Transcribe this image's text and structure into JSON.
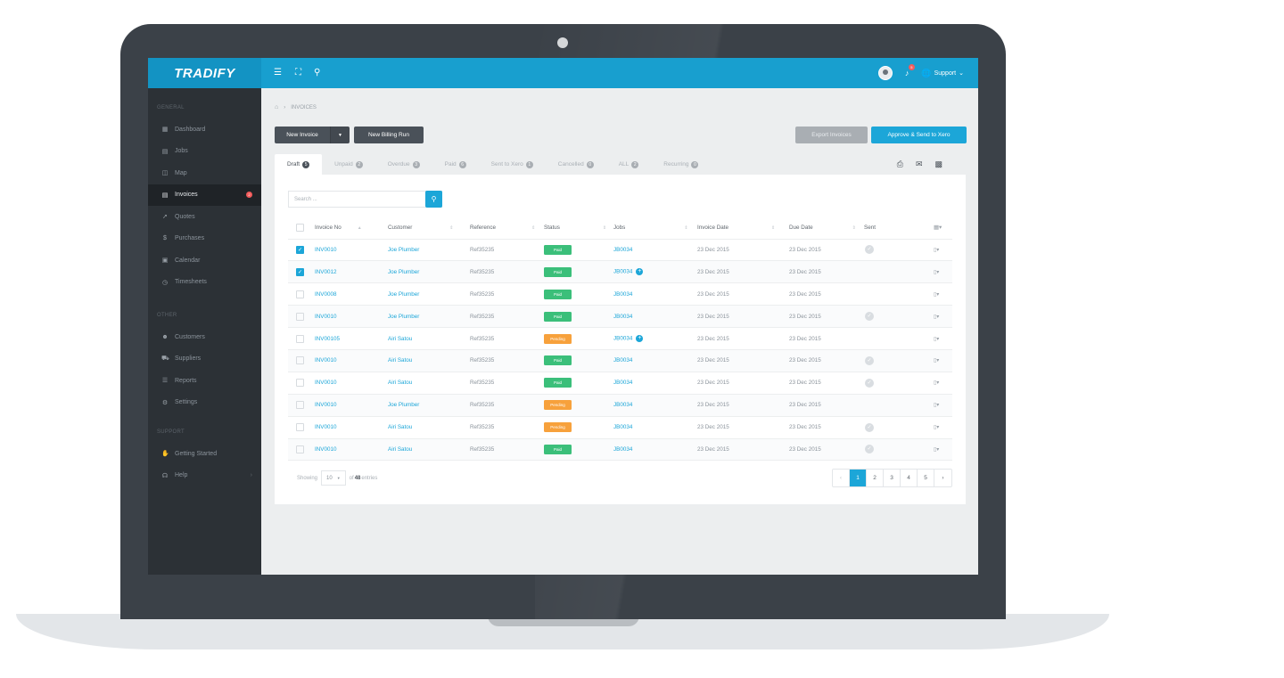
{
  "brand": "TRADIFY",
  "topbar": {
    "menu_icon": "hamburger-icon",
    "expand_icon": "fullscreen-icon",
    "search_icon": "search-icon",
    "notification_count": "5",
    "support_label": "Support"
  },
  "sidebar": {
    "general_label": "GENERAL",
    "other_label": "OTHER",
    "support_label": "SUPPORT",
    "general": [
      {
        "label": "Dashboard",
        "icon": "dashboard-icon"
      },
      {
        "label": "Jobs",
        "icon": "jobs-icon"
      },
      {
        "label": "Map",
        "icon": "map-icon"
      },
      {
        "label": "Invoices",
        "icon": "invoices-icon",
        "badge": "2"
      },
      {
        "label": "Quotes",
        "icon": "quotes-icon"
      },
      {
        "label": "Purchases",
        "icon": "dollar-icon"
      },
      {
        "label": "Calendar",
        "icon": "calendar-icon"
      },
      {
        "label": "Timesheets",
        "icon": "clock-icon"
      }
    ],
    "other": [
      {
        "label": "Customers",
        "icon": "customers-icon"
      },
      {
        "label": "Suppliers",
        "icon": "truck-icon"
      },
      {
        "label": "Reports",
        "icon": "reports-icon"
      },
      {
        "label": "Settings",
        "icon": "gear-icon"
      }
    ],
    "support": [
      {
        "label": "Getting Started",
        "icon": "thumbs-up-icon"
      },
      {
        "label": "Help",
        "icon": "headset-icon"
      }
    ]
  },
  "breadcrumb": {
    "current": "INVOICES"
  },
  "buttons": {
    "new_invoice": "New Invoice",
    "new_billing_run": "New Billing Run",
    "export_invoices": "Export Invoices",
    "approve_send": "Approve & Send to Xero"
  },
  "tabs": [
    {
      "label": "Draft",
      "count": "5"
    },
    {
      "label": "Unpaid",
      "count": "2"
    },
    {
      "label": "Overdue",
      "count": "3"
    },
    {
      "label": "Paid",
      "count": "6"
    },
    {
      "label": "Sent to Xero",
      "count": "1"
    },
    {
      "label": "Cancelled",
      "count": "0"
    },
    {
      "label": "ALL",
      "count": "2"
    },
    {
      "label": "Recurring",
      "count": "0"
    }
  ],
  "search": {
    "placeholder": "Search ..."
  },
  "table": {
    "headers": {
      "invoice_no": "Invoice No",
      "customer": "Customer",
      "reference": "Reference",
      "status": "Status",
      "jobs": "Jobs",
      "invoice_date": "Invoice Date",
      "due_date": "Due Date",
      "sent": "Sent"
    },
    "rows": [
      {
        "checked": true,
        "invoice": "INV0010",
        "customer": "Joe Plumber",
        "reference": "Ref35235",
        "status": "Paid",
        "job": "JB0034",
        "plus": false,
        "invoice_date": "23 Dec 2015",
        "due_date": "23 Dec 2015",
        "sent": true
      },
      {
        "checked": true,
        "invoice": "INV0012",
        "customer": "Joe Plumber",
        "reference": "Ref35235",
        "status": "Paid",
        "job": "JB0034",
        "plus": true,
        "invoice_date": "23 Dec 2015",
        "due_date": "23 Dec 2015",
        "sent": false
      },
      {
        "checked": false,
        "invoice": "INV0008",
        "customer": "Joe Plumber",
        "reference": "Ref35235",
        "status": "Paid",
        "job": "JB0034",
        "plus": false,
        "invoice_date": "23 Dec 2015",
        "due_date": "23 Dec 2015",
        "sent": false
      },
      {
        "checked": false,
        "invoice": "INV0010",
        "customer": "Joe Plumber",
        "reference": "Ref35235",
        "status": "Paid",
        "job": "JB0034",
        "plus": false,
        "invoice_date": "23 Dec 2015",
        "due_date": "23 Dec 2015",
        "sent": true
      },
      {
        "checked": false,
        "invoice": "INV00105",
        "customer": "Airi Satou",
        "reference": "Ref35235",
        "status": "Pending",
        "job": "JB0034",
        "plus": true,
        "invoice_date": "23 Dec 2015",
        "due_date": "23 Dec 2015",
        "sent": false
      },
      {
        "checked": false,
        "invoice": "INV0010",
        "customer": "Airi Satou",
        "reference": "Ref35235",
        "status": "Paid",
        "job": "JB0034",
        "plus": false,
        "invoice_date": "23 Dec 2015",
        "due_date": "23 Dec 2015",
        "sent": true
      },
      {
        "checked": false,
        "invoice": "INV0010",
        "customer": "Airi Satou",
        "reference": "Ref35235",
        "status": "Paid",
        "job": "JB0034",
        "plus": false,
        "invoice_date": "23 Dec 2015",
        "due_date": "23 Dec 2015",
        "sent": true
      },
      {
        "checked": false,
        "invoice": "INV0010",
        "customer": "Joe Plumber",
        "reference": "Ref35235",
        "status": "Pending",
        "job": "JB0034",
        "plus": false,
        "invoice_date": "23 Dec 2015",
        "due_date": "23 Dec 2015",
        "sent": false
      },
      {
        "checked": false,
        "invoice": "INV0010",
        "customer": "Airi Satou",
        "reference": "Ref35235",
        "status": "Pending",
        "job": "JB0034",
        "plus": false,
        "invoice_date": "23 Dec 2015",
        "due_date": "23 Dec 2015",
        "sent": true
      },
      {
        "checked": false,
        "invoice": "INV0010",
        "customer": "Airi Satou",
        "reference": "Ref35235",
        "status": "Paid",
        "job": "JB0034",
        "plus": false,
        "invoice_date": "23 Dec 2015",
        "due_date": "23 Dec 2015",
        "sent": true
      }
    ]
  },
  "footer": {
    "showing_label": "Showing",
    "page_size": "10",
    "of_label": "of",
    "total": "48",
    "entries_label": "entries",
    "pages": [
      "1",
      "2",
      "3",
      "4",
      "5"
    ],
    "current_page": "1"
  },
  "colors": {
    "primary": "#1ca6d8",
    "sidebar": "#2c3136",
    "paid": "#3bbf7a",
    "pending": "#f7a13c",
    "badge": "#f25b5b"
  }
}
